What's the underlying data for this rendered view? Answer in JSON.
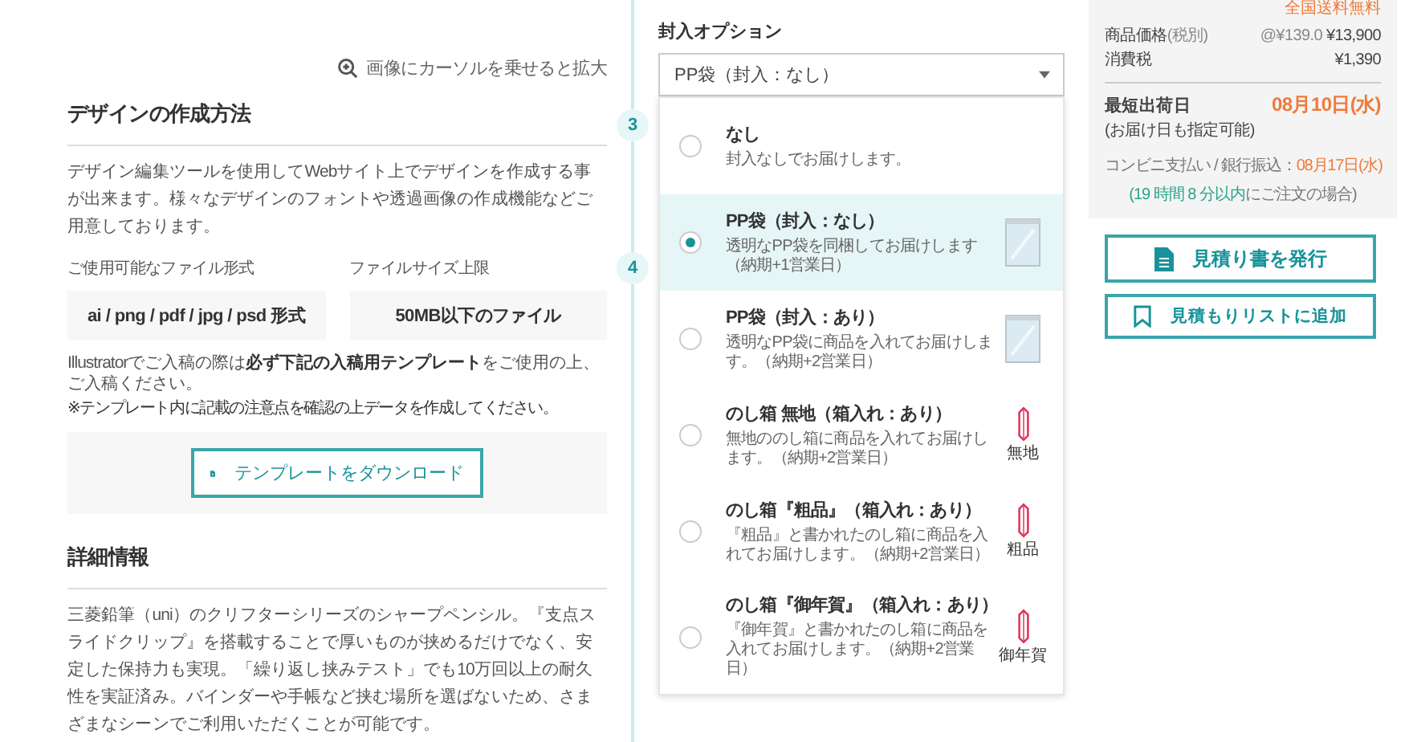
{
  "zoom_hint": "画像にカーソルを乗せると拡大",
  "design": {
    "title": "デザインの作成方法",
    "description": "デザイン編集ツールを使用してWebサイト上でデザインを作成する事が出来ます。様々なデザインのフォントや透過画像の作成機能などご用意しております。",
    "file_formats": {
      "label": "ご使用可能なファイル形式",
      "value": "ai / png / pdf / jpg / psd 形式"
    },
    "file_size": {
      "label": "ファイルサイズ上限",
      "value": "50MB以下のファイル"
    },
    "template_note": "Illustratorでご入稿の際は**必ず下記の入稿用テンプレート**をご使用の上、ご入稿ください。",
    "template_subnote": "※テンプレート内に記載の注意点を確認の上データを作成してください。",
    "download_button": "テンプレートをダウンロード"
  },
  "details": {
    "title": "詳細情報",
    "description": "三菱鉛筆（uni）のクリフターシリーズのシャープペンシル。『支点スライドクリップ』を搭載することで厚いものが挟めるだけでなく、安定した保持力も実現。「繰り返し挟みテスト」でも10万回以上の耐久性を実証済み。バインダーや手帳など挟む場所を選ばないため、さまざまなシーンでご利用いただくことが可能です。"
  },
  "steps": [
    "3",
    "4"
  ],
  "enclosure": {
    "label": "封入オプション",
    "selected_value": "PP袋（封入：なし）",
    "options": [
      {
        "title": "なし",
        "description": "封入なしでお届けします。",
        "kind": "none",
        "selected": false
      },
      {
        "title": "PP袋（封入：なし）",
        "description": "透明なPP袋を同梱してお届けします（納期+1営業日）",
        "kind": "bag",
        "selected": true
      },
      {
        "title": "PP袋（封入：あり）",
        "description": "透明なPP袋に商品を入れてお届けします。（納期+2営業日）",
        "kind": "bag",
        "selected": false
      },
      {
        "title": "のし箱 無地（箱入れ：あり）",
        "description": "無地ののし箱に商品を入れてお届けします。（納期+2営業日）",
        "kind": "noshi",
        "icon_label": "無地",
        "selected": false
      },
      {
        "title": "のし箱『粗品』（箱入れ：あり）",
        "description": "『粗品』と書かれたのし箱に商品を入れてお届けします。（納期+2営業日）",
        "kind": "noshi",
        "icon_label": "粗品",
        "selected": false
      },
      {
        "title": "のし箱『御年賀』（箱入れ：あり）",
        "description": "『御年賀』と書かれたのし箱に商品を入れてお届けします。（納期+2営業日）",
        "kind": "noshi",
        "icon_label": "御年賀",
        "selected": false
      }
    ]
  },
  "summary": {
    "shipping_note": "全国送料無料",
    "price_label": "商品価格",
    "price_label_note": "(税別)",
    "unit_price": "@¥139.0",
    "price": "¥13,900",
    "tax_label": "消費税",
    "tax": "¥1,390",
    "ship_label": "最短出荷日",
    "ship_date": "08月10日(水)",
    "ship_note": "(お届け日も指定可能)",
    "alt_label": "コンビニ支払い / 銀行振込：",
    "alt_date": "08月17日(水)",
    "deadline_highlight": "(19 時間 8 分以内",
    "deadline_rest": "にご注文の場合)"
  },
  "buttons": [
    "見積り書を発行",
    "見積もりリストに追加"
  ]
}
